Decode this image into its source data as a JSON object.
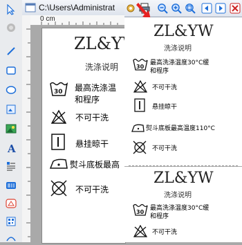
{
  "window": {
    "path": "C:\\Users\\Administrat"
  },
  "ruler": {
    "unit_label": "0 cm"
  },
  "editor_label": {
    "brand": "ZL&YW",
    "subtitle": "洗涤说明",
    "items": [
      {
        "icon": "wash-30-icon",
        "text": "最高洗涤温度30°C缓和程序"
      },
      {
        "icon": "no-dry-clean-icon",
        "text": "不可干洗"
      },
      {
        "icon": "line-dry-icon",
        "text": "悬挂晾干"
      },
      {
        "icon": "iron-110-icon",
        "text": "熨斗底板最高温度110°C"
      },
      {
        "icon": "no-tumble-dry-icon",
        "text": "不可干洗"
      }
    ]
  },
  "editor_visible": {
    "brand": "ZL&YW",
    "subtitle": "洗涤说明",
    "line1a": "最高洗涤温",
    "line1b": "和程序",
    "line2": "不可干洗",
    "line3": "悬挂晾干",
    "line4": "熨斗底板最高",
    "line5": "不可干洗"
  },
  "preview": {
    "label1": {
      "brand": "ZL&YW",
      "subtitle": "洗涤说明",
      "line1a": "最高洗涤温度30°C缓",
      "line1b": "和程序",
      "line2": "不可干洗",
      "line3": "悬挂晾干",
      "line4": "熨斗底板最高温度110°C",
      "line5": "不可干洗"
    },
    "label2": {
      "brand": "ZL&YW",
      "subtitle": "洗涤说明",
      "line1a": "最高洗涤温度30°C缓",
      "line1b": "和程序",
      "line2": "不可干洗"
    }
  },
  "tools": [
    "pointer-icon",
    "pan-icon",
    "line-icon",
    "rectangle-icon",
    "ellipse-icon",
    "image-box-icon",
    "picture-icon",
    "text-icon",
    "rich-text-icon",
    "barcode-icon",
    "shape-icon",
    "qrcode-icon"
  ],
  "colors": {
    "arrow": "#e62222",
    "accent": "#1e6fd9"
  }
}
